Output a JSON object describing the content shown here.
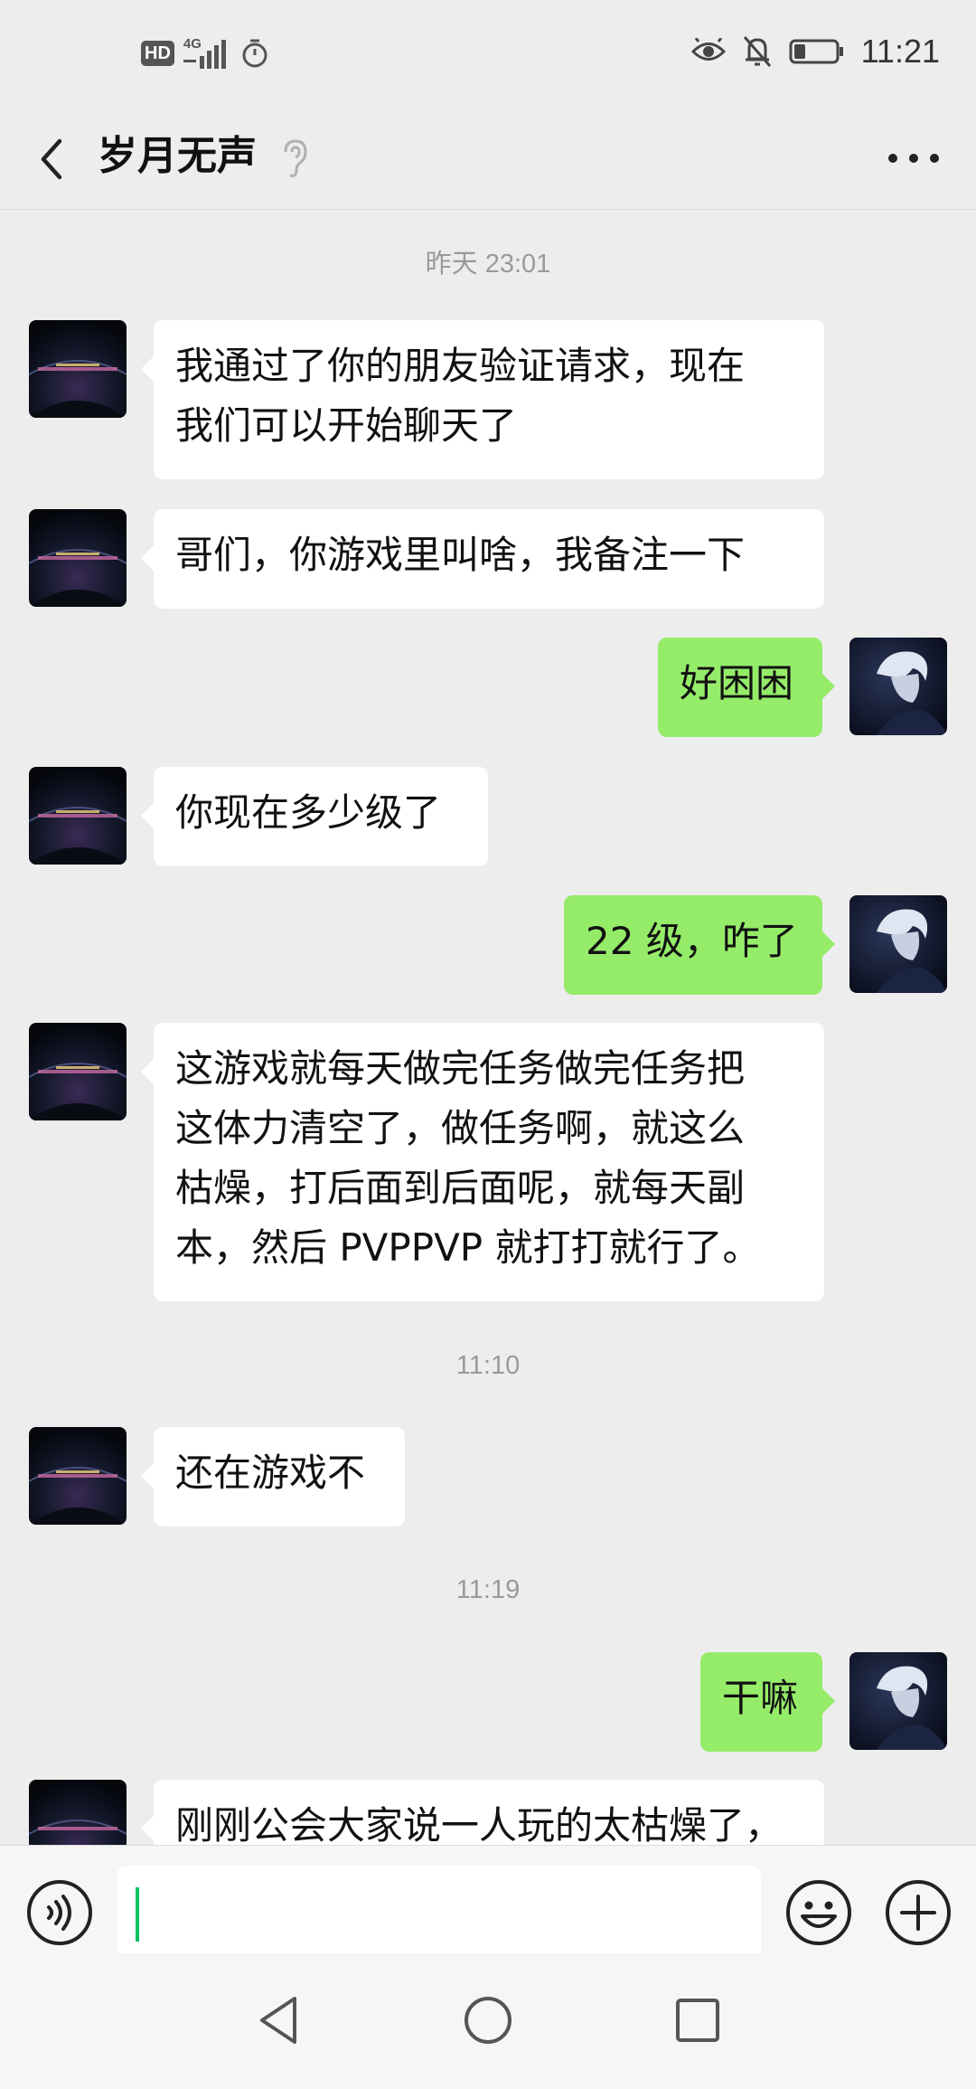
{
  "status_bar": {
    "hd_label": "HD",
    "network_label": "4G",
    "time": "11:21",
    "left_icons": [
      "signal-icon",
      "timer-icon"
    ],
    "right_icons": [
      "eye-icon",
      "bell-off-icon",
      "battery-icon"
    ]
  },
  "header": {
    "title": "岁月无声",
    "back_icon": "chevron-left-icon",
    "ear_icon": "ear-icon",
    "more_icon": "more-dots-icon"
  },
  "timestamps": [
    "昨天 23:01",
    "11:10",
    "11:19"
  ],
  "messages": [
    {
      "side": "left",
      "text": "我通过了你的朋友验证请求，现在\n我们可以开始聊天了"
    },
    {
      "side": "left",
      "text": "哥们，你游戏里叫啥，我备注一下"
    },
    {
      "side": "right",
      "text": "好困困"
    },
    {
      "side": "left",
      "text": "你现在多少级了"
    },
    {
      "side": "right",
      "text": "22 级，咋了"
    },
    {
      "side": "left",
      "text": "这游戏就每天做完任务做完任务把\n这体力清空了，做任务啊，就这么\n枯燥，打后面到后面呢，就每天副\n本，然后 PVPPVP 就打打就行了。"
    },
    {
      "side": "left",
      "text": "还在游戏不"
    },
    {
      "side": "right",
      "text": "干嘛"
    },
    {
      "side": "left",
      "text": "刚刚公会大家说一人玩的太枯燥了，"
    }
  ],
  "input_bar": {
    "voice_icon": "voice-icon",
    "emoji_icon": "emoji-icon",
    "plus_icon": "plus-icon",
    "value": ""
  },
  "nav_bar": {
    "back_icon": "nav-back-icon",
    "home_icon": "nav-home-icon",
    "recent_icon": "nav-recent-icon"
  },
  "colors": {
    "background": "#ededed",
    "bubble_self": "#95ec69",
    "bubble_other": "#ffffff",
    "cursor": "#07c160"
  }
}
